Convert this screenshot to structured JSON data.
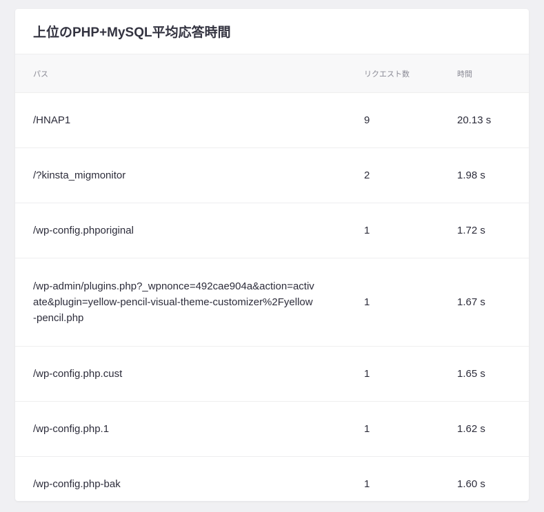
{
  "title": "上位のPHP+MySQL平均応答時間",
  "columns": {
    "path": "パス",
    "requests": "リクエスト数",
    "time": "時間"
  },
  "rows": [
    {
      "path": "/HNAP1",
      "requests": "9",
      "time": "20.13 s"
    },
    {
      "path": "/?kinsta_migmonitor",
      "requests": "2",
      "time": "1.98 s"
    },
    {
      "path": "/wp-config.phporiginal",
      "requests": "1",
      "time": "1.72 s"
    },
    {
      "path": "/wp-admin/plugins.php?_wpnonce=492cae904a&action=activate&plugin=yellow-pencil-visual-theme-customizer%2Fyellow-pencil.php",
      "requests": "1",
      "time": "1.67 s"
    },
    {
      "path": "/wp-config.php.cust",
      "requests": "1",
      "time": "1.65 s"
    },
    {
      "path": "/wp-config.php.1",
      "requests": "1",
      "time": "1.62 s"
    },
    {
      "path": "/wp-config.php-bak",
      "requests": "1",
      "time": "1.60 s"
    }
  ]
}
